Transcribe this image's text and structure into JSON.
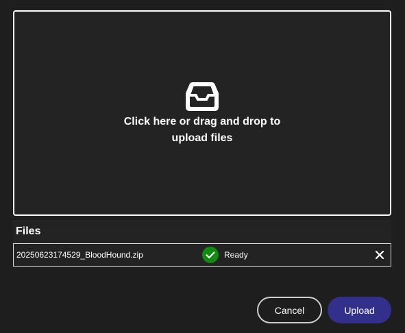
{
  "dropzone": {
    "icon": "inbox-icon",
    "text": "Click here or drag and drop to upload files"
  },
  "files": {
    "heading": "Files",
    "items": [
      {
        "name": "20250623174529_BloodHound.zip",
        "status": "Ready",
        "status_icon": "check-circle-icon",
        "status_color": "#128a12",
        "remove_icon": "close-icon"
      }
    ]
  },
  "actions": {
    "cancel_label": "Cancel",
    "upload_label": "Upload"
  },
  "colors": {
    "background": "#1e1e1e",
    "panel": "#232323",
    "primary": "#33308c",
    "success": "#128a12"
  }
}
